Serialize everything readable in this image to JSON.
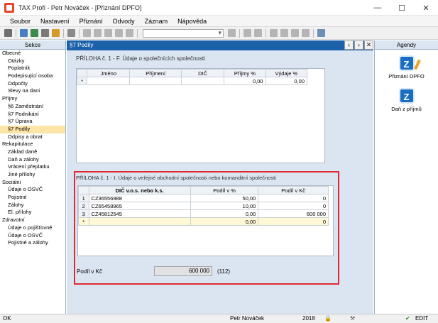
{
  "window": {
    "title": "TAX Profi - Petr Nováček - [Přiznání DPFO]"
  },
  "menu": [
    "Soubor",
    "Nastavení",
    "Přiznání",
    "Odvody",
    "Záznam",
    "Nápověda"
  ],
  "left": {
    "header": "Sekce",
    "items": [
      {
        "label": "Obecné",
        "level": 0
      },
      {
        "label": "Otázky",
        "level": 1
      },
      {
        "label": "Poplatník",
        "level": 1
      },
      {
        "label": "Podepisující osoba",
        "level": 1
      },
      {
        "label": "Odpočty",
        "level": 1
      },
      {
        "label": "Slevy na dani",
        "level": 1
      },
      {
        "label": "Příjmy",
        "level": 0
      },
      {
        "label": "§6 Zaměstnání",
        "level": 1
      },
      {
        "label": "§7 Podnikání",
        "level": 1
      },
      {
        "label": "§7 Úprava",
        "level": 1
      },
      {
        "label": "§7 Podíly",
        "level": 1,
        "selected": true
      },
      {
        "label": "Odpisy a obrat",
        "level": 1
      },
      {
        "label": "Rekapitulace",
        "level": 0
      },
      {
        "label": "Základ daně",
        "level": 1
      },
      {
        "label": "Daň a zálohy",
        "level": 1
      },
      {
        "label": "Vrácení přeplatku",
        "level": 1
      },
      {
        "label": "Jiné přílohy",
        "level": 1
      },
      {
        "label": "Sociální",
        "level": 0
      },
      {
        "label": "Údaje o OSVČ",
        "level": 1
      },
      {
        "label": "Pojistné",
        "level": 1
      },
      {
        "label": "Zálohy",
        "level": 1
      },
      {
        "label": "El. přílohy",
        "level": 1
      },
      {
        "label": "Zdravotní",
        "level": 0
      },
      {
        "label": "Údaje o pojišťovně",
        "level": 1
      },
      {
        "label": "Údaje o OSVČ",
        "level": 1
      },
      {
        "label": "Pojistné a zálohy",
        "level": 1
      }
    ]
  },
  "main": {
    "tab_title": "§7 Podíly",
    "section1": {
      "title": "PŘÍLOHA č. 1 - F. Údaje o společnících společnosti",
      "columns": [
        "Jméno",
        "Příjmení",
        "DIČ",
        "Příjmy %",
        "Výdaje %"
      ],
      "row": {
        "marker": "*",
        "jmeno": "",
        "prijmeni": "",
        "dic": "",
        "prijmy": "0,00",
        "vydaje": "0,00"
      }
    },
    "section2": {
      "title": "PŘÍLOHA č. 1 - I. Údaje o veřejné obchodní společnosti nebo komanditní společnosti",
      "columns": [
        "DIČ v.o.s. nebo k.s.",
        "Podíl v %",
        "Podíl v Kč"
      ],
      "rows": [
        {
          "marker": "1",
          "dic": "CZ36556988",
          "pct": "50,00",
          "kc": "0"
        },
        {
          "marker": "2",
          "dic": "CZ65458965",
          "pct": "10,00",
          "kc": "0"
        },
        {
          "marker": "3",
          "dic": "CZ45812545",
          "pct": "0,00",
          "kc": "600 000"
        },
        {
          "marker": "*",
          "dic": "",
          "pct": "0,00",
          "kc": "0"
        }
      ],
      "sum_label": "Podíl v Kč",
      "sum_value": "600 000",
      "sum_code": "(112)"
    }
  },
  "right": {
    "header": "Agendy",
    "items": [
      {
        "label": "Přiznání DPFO",
        "icon": "tax-return-icon"
      },
      {
        "label": "Daň z příjmů",
        "icon": "income-tax-icon"
      }
    ]
  },
  "status": {
    "left": "OK",
    "user": "Petr Nováček",
    "year": "2018",
    "mode": "EDIT"
  },
  "colors": {
    "tab": "#1b62ab",
    "highlight": "#e02a33",
    "selected": "#fde5a7"
  }
}
